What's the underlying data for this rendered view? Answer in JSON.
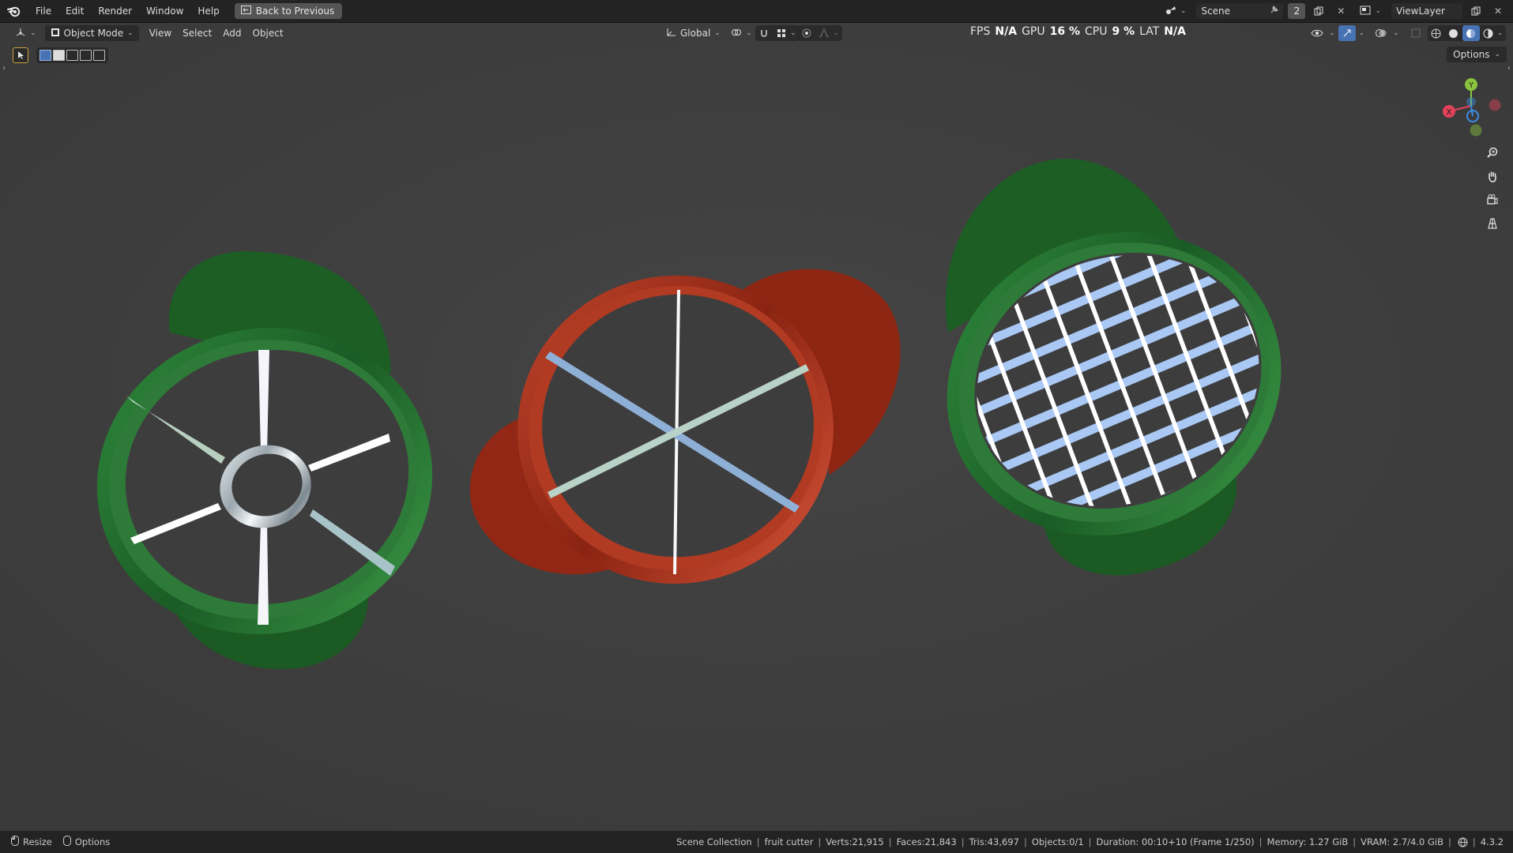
{
  "menu": {
    "items": [
      "File",
      "Edit",
      "Render",
      "Window",
      "Help"
    ],
    "back_button": "Back to Previous"
  },
  "top_right": {
    "scene_label": "Scene",
    "scene_count": "2",
    "view_layer_label": "ViewLayer"
  },
  "viewport_header": {
    "mode": "Object Mode",
    "menus": [
      "View",
      "Select",
      "Add",
      "Object"
    ],
    "transform_orientation": "Global",
    "options_label": "Options"
  },
  "stats": {
    "fps_label": "FPS",
    "fps_value": "N/A",
    "gpu_label": "GPU",
    "gpu_value": "16 %",
    "cpu_label": "CPU",
    "cpu_value": "9 %",
    "lat_label": "LAT",
    "lat_value": "N/A"
  },
  "gizmo": {
    "y_label": "Y",
    "x_label": "X",
    "colors": {
      "x": "#e2425b",
      "y": "#8bc53f",
      "z": "#3b8ee6"
    }
  },
  "status": {
    "left_resize": "Resize",
    "left_options": "Options",
    "collection": "Scene Collection",
    "object": "fruit cutter",
    "verts": "Verts:21,915",
    "faces": "Faces:21,843",
    "tris": "Tris:43,697",
    "objects": "Objects:0/1",
    "duration": "Duration: 00:10+10 (Frame 1/250)",
    "memory": "Memory: 1.27 GiB",
    "vram": "VRAM: 2.7/4.0 GiB",
    "version": "4.3.2"
  },
  "colors": {
    "viewport_bg": "#3d3d3d",
    "green_cutter": "#1f6b2a",
    "red_cutter": "#a02a14",
    "blade": "#aac8f2",
    "accent": "#4772b3"
  }
}
